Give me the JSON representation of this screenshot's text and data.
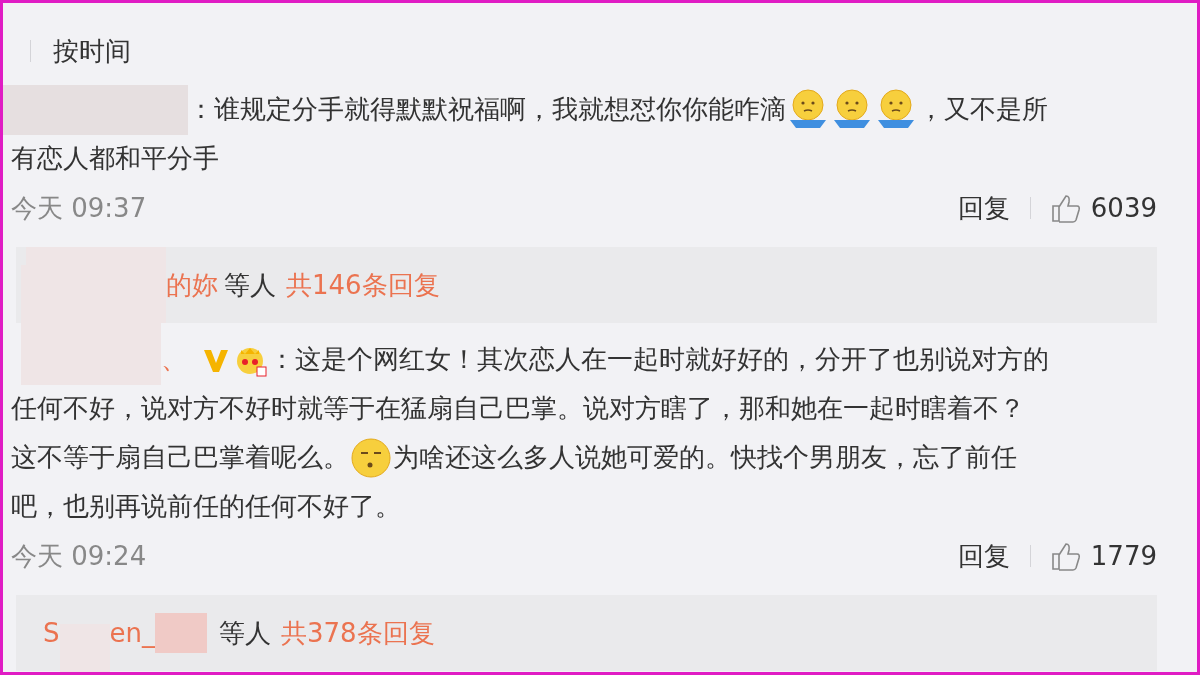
{
  "sort_bar": {
    "label": "按时间"
  },
  "comments": [
    {
      "author": [
        {
          "kind": "redaction"
        }
      ],
      "lines": [
        [
          {
            "kind": "text",
            "text": "：谁规定分手就得默默祝福啊，我就想怼你你能咋滴"
          },
          {
            "kind": "emoji_basin"
          },
          {
            "kind": "emoji_basin"
          },
          {
            "kind": "emoji_basin"
          },
          {
            "kind": "text",
            "text": "，又不是所"
          }
        ],
        [
          {
            "kind": "text",
            "text": "有恋人都和平分手"
          }
        ]
      ],
      "time": "今天 09:37",
      "reply": "回复",
      "likes": "6039",
      "summary": {
        "names": [
          {
            "kind": "redaction"
          },
          {
            "kind": "text",
            "text": "的妳"
          }
        ],
        "middle": "等人",
        "count": "共146条回复"
      }
    },
    {
      "author": [
        {
          "kind": "redaction_tall"
        },
        {
          "kind": "text",
          "text": "、"
        },
        {
          "kind": "vip_badge"
        },
        {
          "kind": "crown_emoji"
        }
      ],
      "lines": [
        [
          {
            "kind": "text",
            "text": "：这是个网红女！其次恋人在一起时就好好的，分开了也别说对方的"
          }
        ],
        [
          {
            "kind": "text",
            "text": "任何不好，说对方不好时就等于在猛扇自己巴掌。说对方瞎了，那和她在一起时瞎着不？"
          }
        ],
        [
          {
            "kind": "text",
            "text": "这不等于扇自己巴掌着呢么。"
          },
          {
            "kind": "emoji_sleepy"
          },
          {
            "kind": "text",
            "text": "为啥还这么多人说她可爱的。快找个男朋友，忘了前任"
          }
        ],
        [
          {
            "kind": "text",
            "text": "吧，也别再说前任的任何不好了。"
          }
        ]
      ],
      "time": "今天 09:24",
      "reply": "回复",
      "likes": "1779",
      "summary": {
        "names": [
          {
            "kind": "text",
            "text": "S"
          },
          {
            "kind": "redaction_small"
          },
          {
            "kind": "text",
            "text": "en_"
          },
          {
            "kind": "redaction_wide"
          }
        ],
        "middle": "等人",
        "count": "共378条回复"
      }
    }
  ]
}
